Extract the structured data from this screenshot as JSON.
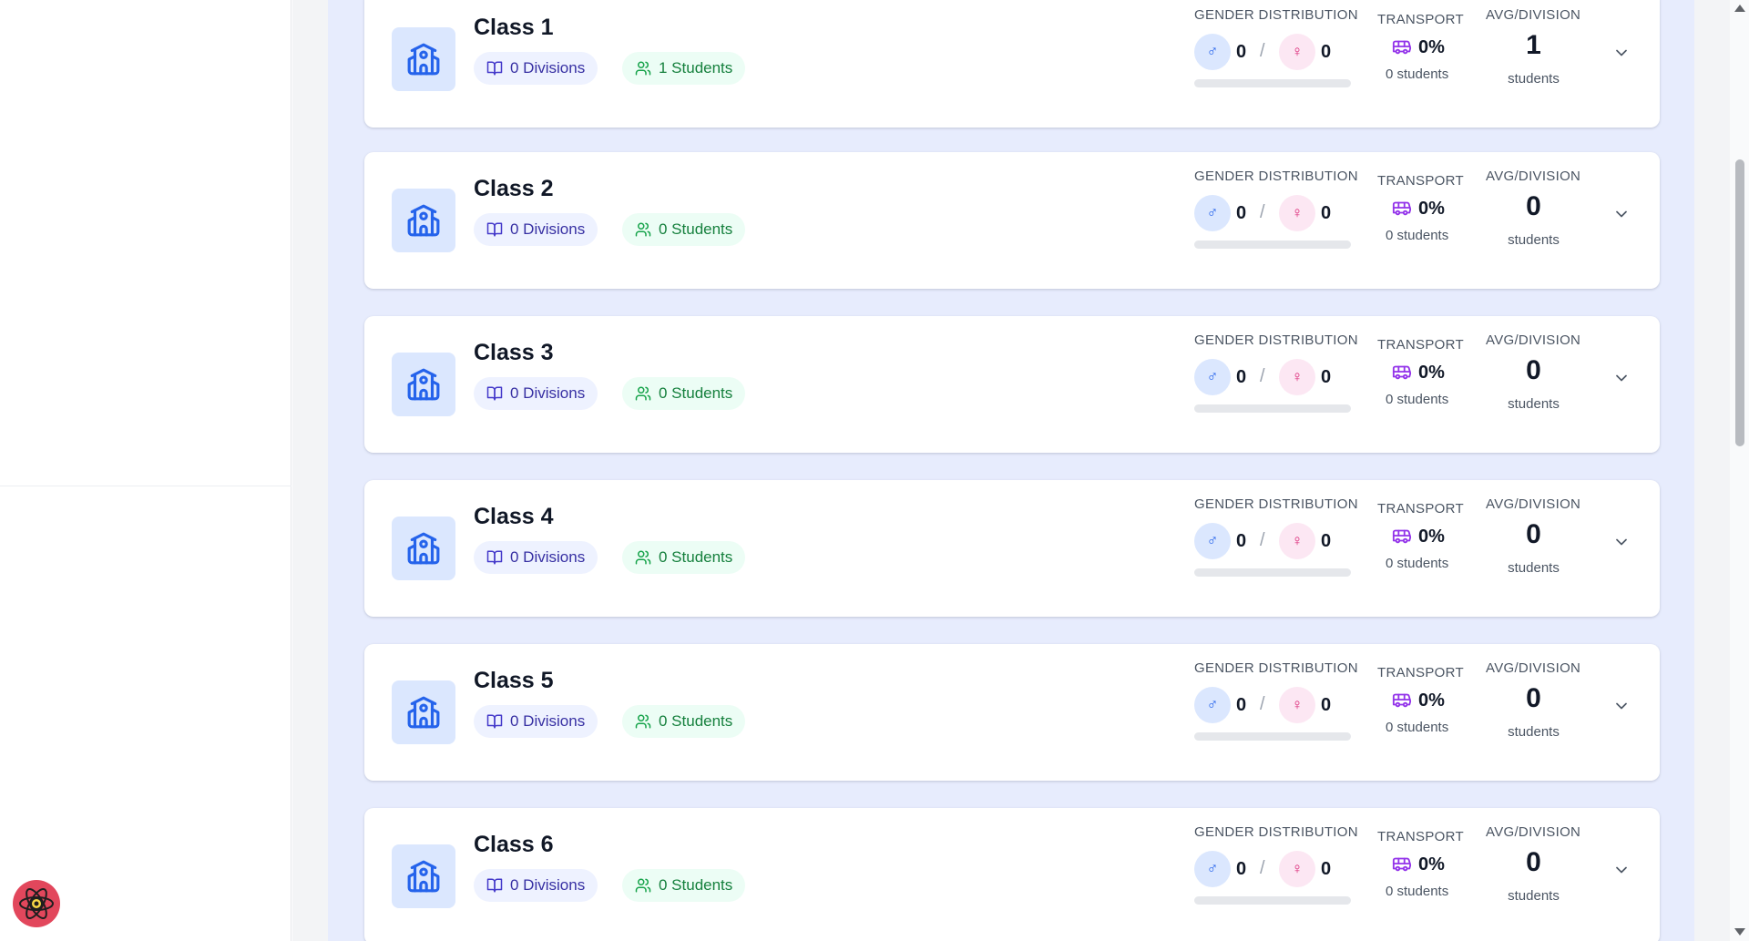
{
  "labels": {
    "gender": "GENDER DISTRIBUTION",
    "transport": "TRANSPORT",
    "avg": "AVG/DIVISION",
    "avg_sub": "students",
    "slash": "/",
    "male_symbol": "♂",
    "female_symbol": "♀"
  },
  "colors": {
    "panel": "#e7ecfd",
    "primary": "#2563eb",
    "divisions_pill": "#eef2ff",
    "students_pill": "#ecfdf5",
    "transport_icon": "#9333ea"
  },
  "icons": {
    "class": "school-icon",
    "divisions": "book-open-icon",
    "students": "users-icon",
    "transport": "bus-icon",
    "expand": "chevron-down-icon",
    "devtools": "react-devtools-icon"
  },
  "classes": [
    {
      "title": "Class 1",
      "divisions": "0 Divisions",
      "students": "1 Students",
      "male": "0",
      "female": "0",
      "transport_pct": "0%",
      "transport_students": "0 students",
      "avg": "1",
      "male_ratio": 0
    },
    {
      "title": "Class 2",
      "divisions": "0 Divisions",
      "students": "0 Students",
      "male": "0",
      "female": "0",
      "transport_pct": "0%",
      "transport_students": "0 students",
      "avg": "0",
      "male_ratio": 0
    },
    {
      "title": "Class 3",
      "divisions": "0 Divisions",
      "students": "0 Students",
      "male": "0",
      "female": "0",
      "transport_pct": "0%",
      "transport_students": "0 students",
      "avg": "0",
      "male_ratio": 0
    },
    {
      "title": "Class 4",
      "divisions": "0 Divisions",
      "students": "0 Students",
      "male": "0",
      "female": "0",
      "transport_pct": "0%",
      "transport_students": "0 students",
      "avg": "0",
      "male_ratio": 0
    },
    {
      "title": "Class 5",
      "divisions": "0 Divisions",
      "students": "0 Students",
      "male": "0",
      "female": "0",
      "transport_pct": "0%",
      "transport_students": "0 students",
      "avg": "0",
      "male_ratio": 0
    },
    {
      "title": "Class 6",
      "divisions": "0 Divisions",
      "students": "0 Students",
      "male": "0",
      "female": "0",
      "transport_pct": "0%",
      "transport_students": "0 students",
      "avg": "0",
      "male_ratio": 0
    }
  ]
}
